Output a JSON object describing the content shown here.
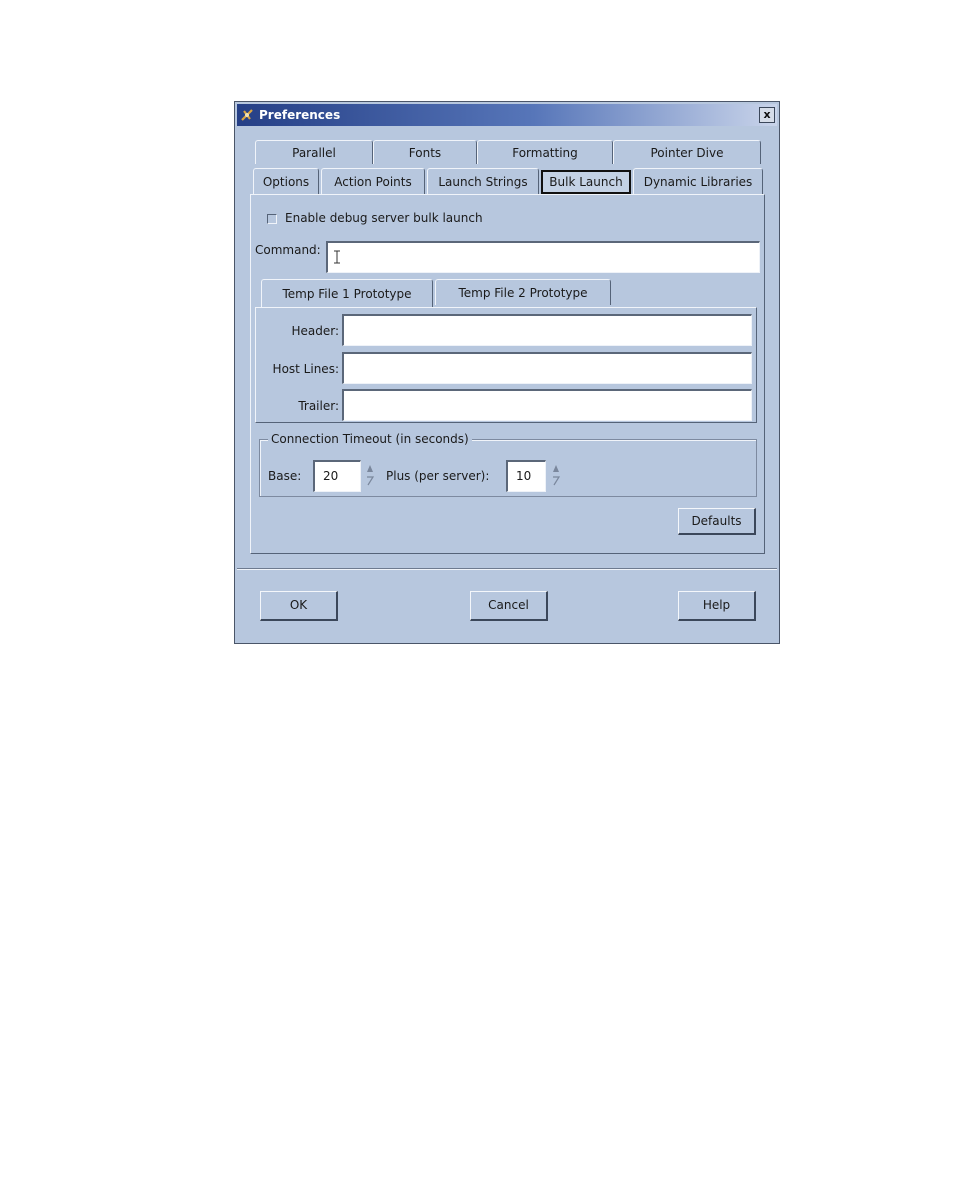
{
  "window": {
    "title": "Preferences",
    "close_glyph": "x"
  },
  "tabs_row1": [
    {
      "label": "Parallel"
    },
    {
      "label": "Fonts"
    },
    {
      "label": "Formatting"
    },
    {
      "label": "Pointer Dive"
    }
  ],
  "tabs_row2": [
    {
      "label": "Options"
    },
    {
      "label": "Action Points"
    },
    {
      "label": "Launch Strings"
    },
    {
      "label": "Bulk Launch",
      "selected": true
    },
    {
      "label": "Dynamic Libraries"
    }
  ],
  "bulk_launch": {
    "enable_checkbox_label": "Enable debug server bulk launch",
    "enable_checked": false,
    "command_label": "Command:",
    "command_value": "",
    "subtabs": [
      {
        "label": "Temp File 1 Prototype",
        "selected": true
      },
      {
        "label": "Temp File 2 Prototype"
      }
    ],
    "header_label": "Header:",
    "header_value": "",
    "host_lines_label": "Host Lines:",
    "host_lines_value": "",
    "trailer_label": "Trailer:",
    "trailer_value": "",
    "timeout_group_title": "Connection Timeout (in seconds)",
    "base_label": "Base:",
    "base_value": "20",
    "plus_label": "Plus (per server):",
    "plus_value": "10",
    "defaults_button": "Defaults"
  },
  "footer": {
    "ok_button": "OK",
    "cancel_button": "Cancel",
    "help_button": "Help"
  }
}
